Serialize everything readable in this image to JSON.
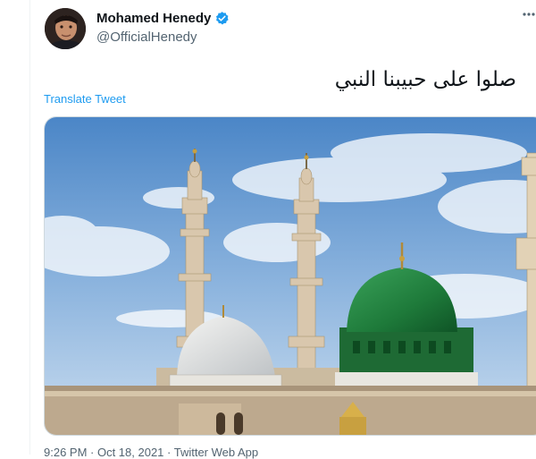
{
  "tweet": {
    "author_name": "Mohamed Henedy",
    "handle": "@OfficialHenedy",
    "text": "صلوا على حبيبنا النبي",
    "translate_label": "Translate Tweet",
    "meta": "9:26 PM · Oct 18, 2021 · Twitter Web App"
  },
  "icons": {
    "verified": "verified-badge-icon",
    "more": "more-options-icon"
  },
  "colors": {
    "link": "#1d9bf0",
    "verified": "#1d9bf0",
    "secondary_text": "#536471",
    "dome_green": "#1e7a3a"
  }
}
